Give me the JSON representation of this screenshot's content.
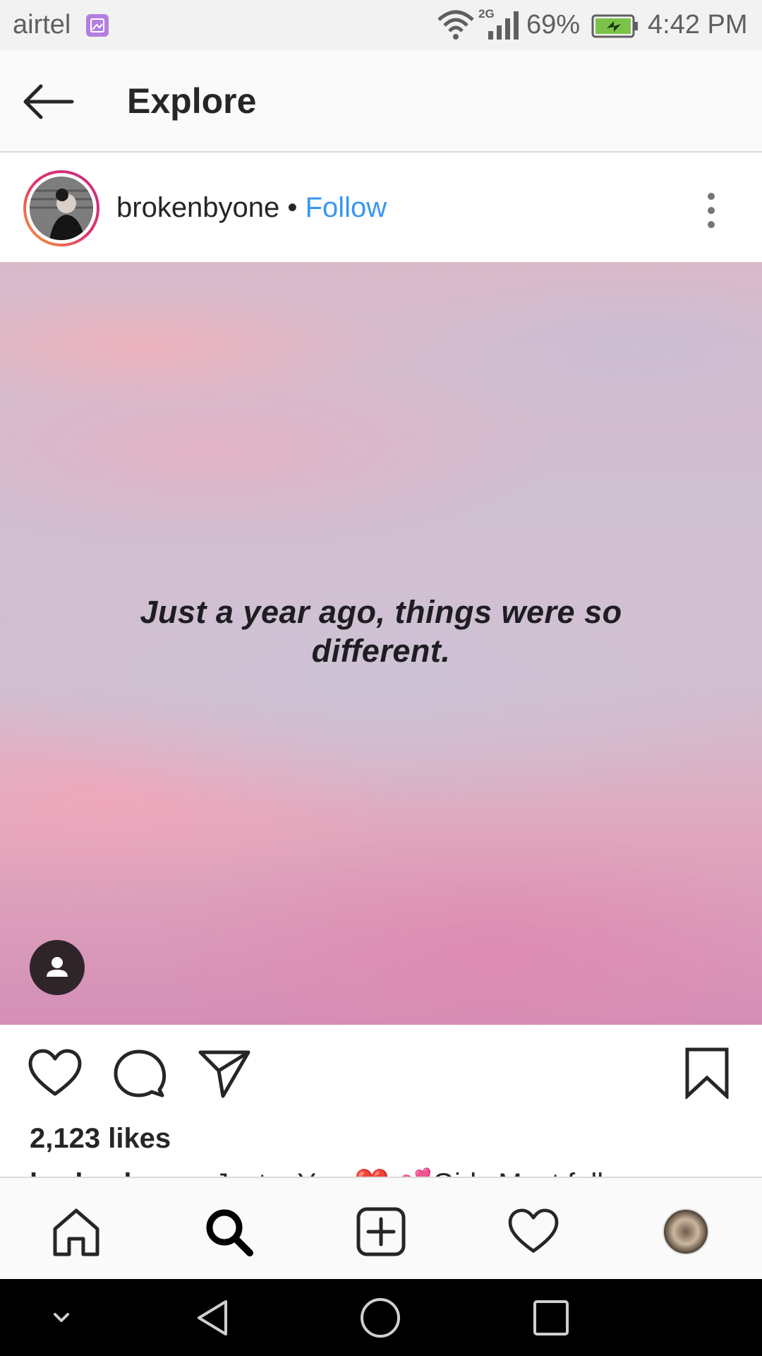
{
  "status_bar": {
    "carrier": "airtel",
    "network_type": "2G",
    "battery_percent": "69%",
    "time": "4:42 PM",
    "icons": [
      "gallery-notification-icon",
      "wifi-icon",
      "signal-icon",
      "battery-charging-icon"
    ]
  },
  "header": {
    "title": "Explore",
    "back_icon": "arrow-left-icon"
  },
  "post": {
    "username": "brokenbyone",
    "separator": "•",
    "follow_label": "Follow",
    "more_icon": "more-vertical-icon",
    "image_text": "Just a year ago, things were so different.",
    "image_text_line1": "Just a year ago, things were so",
    "image_text_line2": "different.",
    "likes": "2,123 likes",
    "caption_username": "brokenbyone",
    "caption_text": "Just a Year❤️ 💕Girls Must follow",
    "actions": [
      "heart-icon",
      "comment-icon",
      "share-icon",
      "bookmark-icon"
    ],
    "tag_icon": "user-tag-icon"
  },
  "bottom_nav": {
    "items": [
      "home",
      "search",
      "add",
      "activity",
      "profile"
    ],
    "active": "search"
  },
  "system_nav": {
    "items": [
      "collapse",
      "back",
      "home",
      "recents"
    ]
  },
  "colors": {
    "follow_blue": "#3897f0",
    "text_primary": "#262626",
    "avatar_ring_start": "#f9a13a",
    "avatar_ring_end": "#c13584"
  }
}
